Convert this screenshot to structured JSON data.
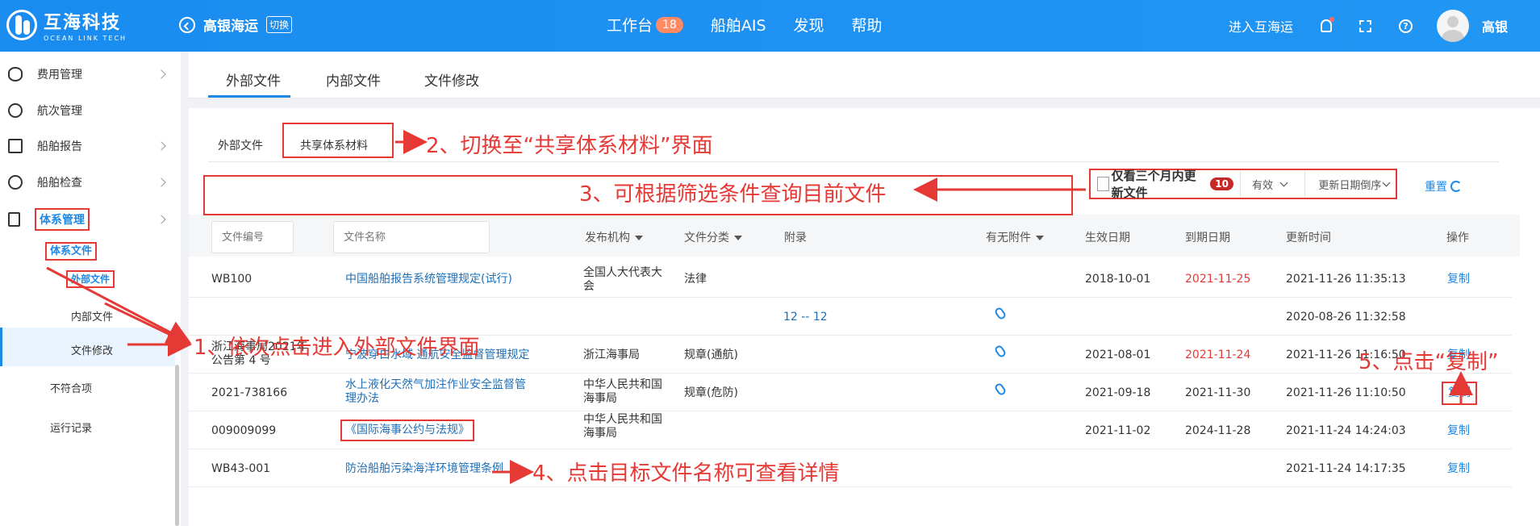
{
  "header": {
    "logo_cn": "互海科技",
    "logo_en": "OCEAN LINK TECH",
    "company": "高银海运",
    "switch_label": "切换",
    "nav": [
      {
        "label": "工作台",
        "badge": "18"
      },
      {
        "label": "船舶AIS"
      },
      {
        "label": "发现"
      },
      {
        "label": "帮助"
      }
    ],
    "enter_label": "进入互海运",
    "username": "高银",
    "accent_color": "#1e90ff"
  },
  "sidebar": {
    "items": [
      {
        "label": "费用管理",
        "icon": "database-icon"
      },
      {
        "label": "航次管理",
        "icon": "globe-icon"
      },
      {
        "label": "船舶报告",
        "icon": "calendar-icon"
      },
      {
        "label": "船舶检查",
        "icon": "check-circle-icon"
      },
      {
        "label": "体系管理",
        "icon": "document-icon"
      }
    ],
    "sub_items": [
      "体系文件",
      "外部文件",
      "内部文件",
      "文件修改",
      "不符合项",
      "运行记录"
    ]
  },
  "tabs": [
    "外部文件",
    "内部文件",
    "文件修改"
  ],
  "subtabs": [
    "外部文件",
    "共享体系材料"
  ],
  "filters": {
    "recent_label": "仅看三个月内更新文件",
    "recent_count": "10",
    "status_value": "有效",
    "sort_value": "更新日期倒序",
    "reset_label": "重置"
  },
  "table": {
    "code_placeholder": "文件编号",
    "name_placeholder": "文件名称",
    "columns": [
      "发布机构",
      "文件分类",
      "附录",
      "有无附件",
      "生效日期",
      "到期日期",
      "更新时间",
      "操作"
    ],
    "rows": [
      {
        "code": "WB100",
        "name": "中国船舶报告系统管理规定(试行)",
        "org": "全国人大代表大会",
        "category": "法律",
        "appendix": "",
        "attachment": false,
        "effective": "2018-10-01",
        "expire": "2021-11-25",
        "expire_red": true,
        "updated": "2021-11-26 11:35:13",
        "action": "复制"
      },
      {
        "code": "",
        "name": "",
        "org": "",
        "category": "",
        "appendix": "12 -- 12",
        "attachment": true,
        "effective": "",
        "expire": "",
        "expire_red": false,
        "updated": "2020-08-26 11:32:58",
        "action": ""
      },
      {
        "code": "浙江海事局2021年公告第 4 号",
        "name": "宁波穿白水域 通航安全监督管理规定",
        "org": "浙江海事局",
        "category": "规章(通航)",
        "appendix": "",
        "attachment": true,
        "effective": "2021-08-01",
        "expire": "2021-11-24",
        "expire_red": true,
        "updated": "2021-11-26 11:16:50",
        "action": "复制"
      },
      {
        "code": "2021-738166",
        "name": "水上液化天然气加注作业安全监督管理办法",
        "org": "中华人民共和国海事局",
        "category": "规章(危防)",
        "appendix": "",
        "attachment": true,
        "effective": "2021-09-18",
        "expire": "2021-11-30",
        "expire_red": false,
        "updated": "2021-11-26 11:10:50",
        "action": "复制"
      },
      {
        "code": "009009099",
        "name": "《国际海事公约与法规》",
        "org": "中华人民共和国海事局",
        "category": "",
        "appendix": "",
        "attachment": false,
        "effective": "2021-11-02",
        "expire": "2024-11-28",
        "expire_red": false,
        "updated": "2021-11-24 14:24:03",
        "action": "复制"
      },
      {
        "code": "WB43-001",
        "name": "防治船舶污染海洋环境管理条例",
        "org": "",
        "category": "",
        "appendix": "",
        "attachment": false,
        "effective": "",
        "expire": "",
        "expire_red": false,
        "updated": "2021-11-24 14:17:35",
        "action": "复制"
      }
    ]
  },
  "annotations": {
    "step1": "1、依次点击进入外部文件界面",
    "step2": "2、切换至“共享体系材料”界面",
    "step3": "3、可根据筛选条件查询目前文件",
    "step4": "4、点击目标文件名称可查看详情",
    "step5": "5、点击“复制”"
  }
}
